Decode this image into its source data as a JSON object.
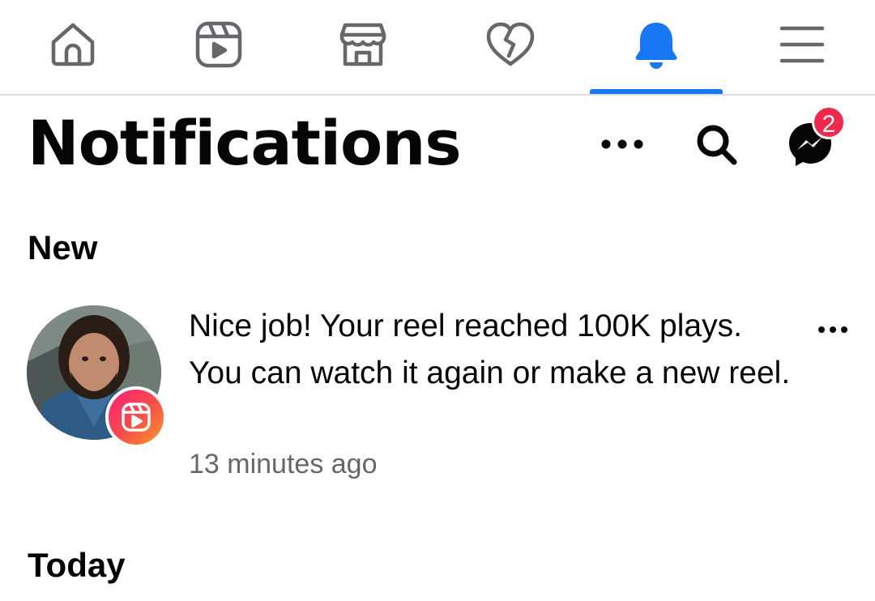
{
  "nav": {
    "tabs": [
      {
        "name": "Home",
        "icon": "home-icon"
      },
      {
        "name": "Reels",
        "icon": "reels-icon"
      },
      {
        "name": "Marketplace",
        "icon": "marketplace-icon"
      },
      {
        "name": "Dating",
        "icon": "heart-icon"
      },
      {
        "name": "Notifications",
        "icon": "bell-icon",
        "active": true
      },
      {
        "name": "Menu",
        "icon": "hamburger-menu-icon"
      }
    ]
  },
  "header": {
    "title": "Notifications",
    "messenger_badge_count": "2"
  },
  "sections": {
    "new_label": "New",
    "today_label": "Today"
  },
  "notifications": [
    {
      "text": "Nice job! Your reel reached 100K plays. You can watch it again or make a new reel.",
      "time": "13 minutes ago",
      "badge_icon": "reels-icon"
    }
  ],
  "colors": {
    "accent": "#1877f2",
    "icon_gray": "#65676b",
    "badge_red": "#f02849",
    "secondary_text": "#65676b"
  }
}
